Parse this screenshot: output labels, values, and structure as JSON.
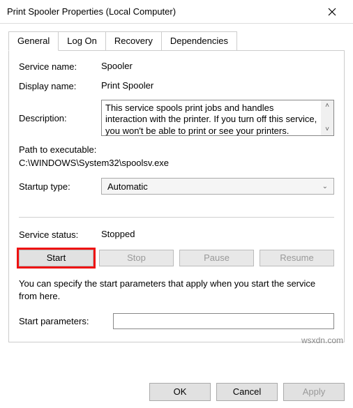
{
  "window": {
    "title": "Print Spooler Properties (Local Computer)"
  },
  "tabs": {
    "general": "General",
    "logon": "Log On",
    "recovery": "Recovery",
    "dependencies": "Dependencies"
  },
  "labels": {
    "service_name": "Service name:",
    "display_name": "Display name:",
    "description": "Description:",
    "path_label": "Path to executable:",
    "startup_type": "Startup type:",
    "service_status": "Service status:",
    "start_params": "Start parameters:",
    "hint": "You can specify the start parameters that apply when you start the service from here."
  },
  "values": {
    "service_name": "Spooler",
    "display_name": "Print Spooler",
    "description": "This service spools print jobs and handles interaction with the printer.  If you turn off this service, you won't be able to print or see your printers.",
    "path": "C:\\WINDOWS\\System32\\spoolsv.exe",
    "startup_type": "Automatic",
    "status": "Stopped",
    "start_params": ""
  },
  "buttons": {
    "start": "Start",
    "stop": "Stop",
    "pause": "Pause",
    "resume": "Resume",
    "ok": "OK",
    "cancel": "Cancel",
    "apply": "Apply"
  },
  "watermark": "wsxdn.com"
}
